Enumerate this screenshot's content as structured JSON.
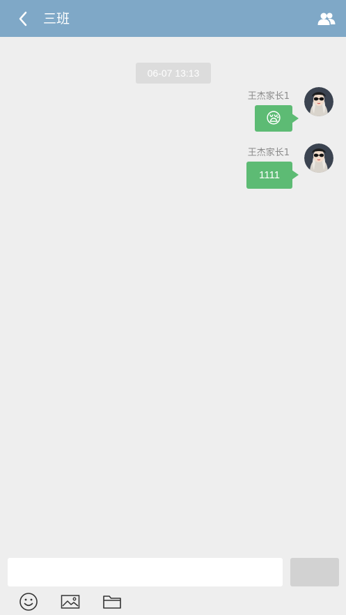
{
  "header": {
    "title": "三班",
    "back_icon": "chevron-left-icon",
    "members_icon": "group-icon",
    "background": "#7fa8c7"
  },
  "chat": {
    "timestamp": "06-07 13:13",
    "messages": [
      {
        "sender": "王杰家长1",
        "type": "emoji",
        "content": "😪",
        "bubble_color": "#5dbb74"
      },
      {
        "sender": "王杰家长1",
        "type": "text",
        "content": "1111",
        "bubble_color": "#5dbb74"
      }
    ]
  },
  "input_bar": {
    "text_value": "",
    "send_label": "",
    "tools": [
      "smiley-icon",
      "image-icon",
      "folder-icon"
    ]
  }
}
